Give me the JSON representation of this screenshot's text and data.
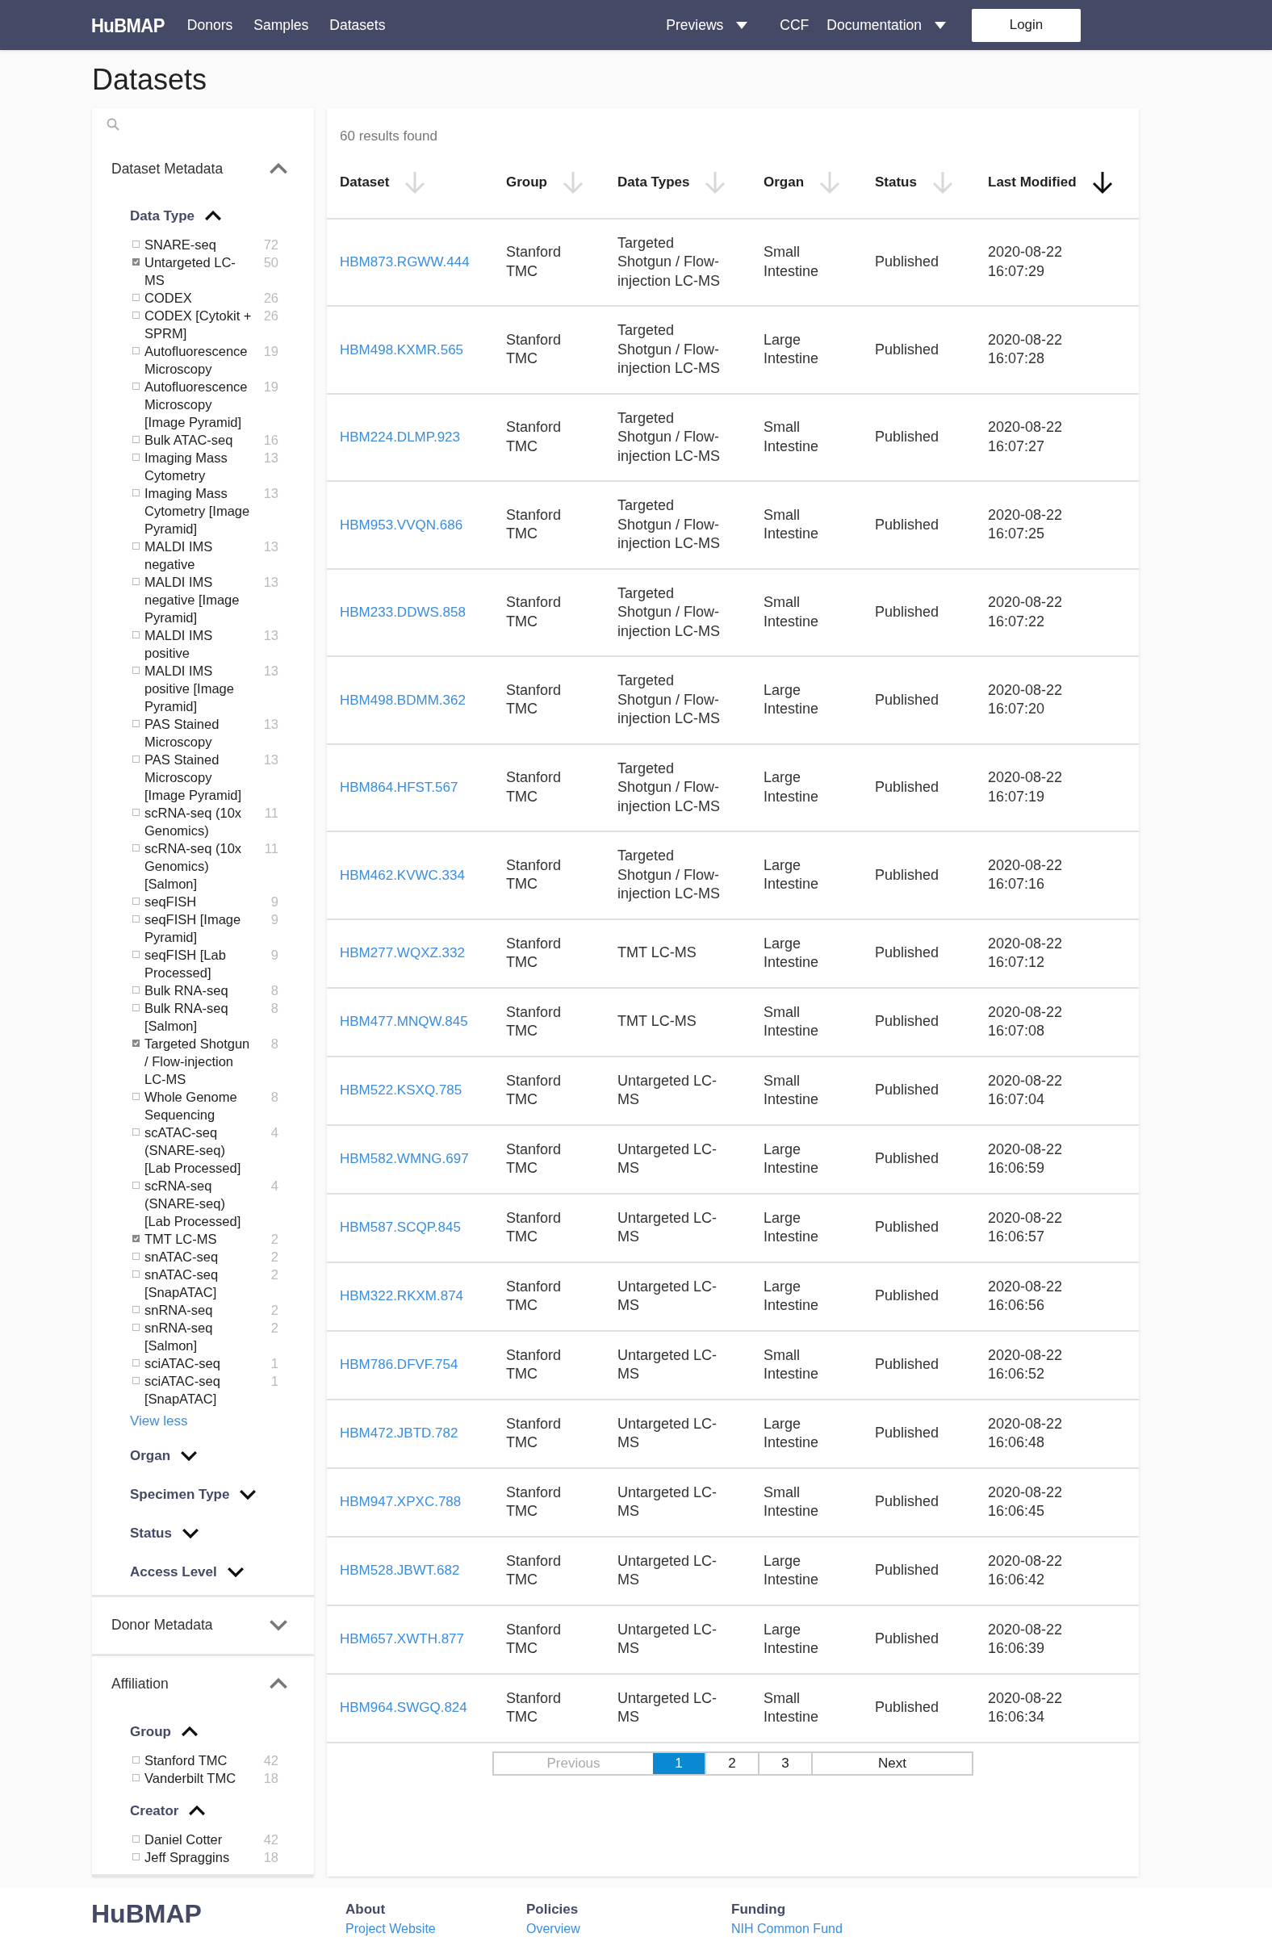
{
  "nav": {
    "logo": "HuBMAP",
    "links": [
      "Donors",
      "Samples",
      "Datasets"
    ],
    "right": [
      {
        "label": "Previews",
        "dropdown": true
      },
      {
        "label": "CCF",
        "dropdown": false
      },
      {
        "label": "Documentation",
        "dropdown": true
      }
    ],
    "login": "Login"
  },
  "page_title": "Datasets",
  "sidebar": {
    "sections": [
      {
        "title": "Dataset Metadata",
        "expanded": true,
        "facets": [
          {
            "title": "Data Type",
            "expanded": true,
            "items": [
              {
                "label": "SNARE-seq",
                "count": "72",
                "checked": false
              },
              {
                "label": "Untargeted LC-MS",
                "count": "50",
                "checked": true
              },
              {
                "label": "CODEX",
                "count": "26",
                "checked": false
              },
              {
                "label": "CODEX [Cytokit + SPRM]",
                "count": "26",
                "checked": false
              },
              {
                "label": "Autofluorescence Microscopy",
                "count": "19",
                "checked": false
              },
              {
                "label": "Autofluorescence Microscopy [Image Pyramid]",
                "count": "19",
                "checked": false
              },
              {
                "label": "Bulk ATAC-seq",
                "count": "16",
                "checked": false
              },
              {
                "label": "Imaging Mass Cytometry",
                "count": "13",
                "checked": false
              },
              {
                "label": "Imaging Mass Cytometry [Image Pyramid]",
                "count": "13",
                "checked": false
              },
              {
                "label": "MALDI IMS negative",
                "count": "13",
                "checked": false
              },
              {
                "label": "MALDI IMS negative [Image Pyramid]",
                "count": "13",
                "checked": false
              },
              {
                "label": "MALDI IMS positive",
                "count": "13",
                "checked": false
              },
              {
                "label": "MALDI IMS positive [Image Pyramid]",
                "count": "13",
                "checked": false
              },
              {
                "label": "PAS Stained Microscopy",
                "count": "13",
                "checked": false
              },
              {
                "label": "PAS Stained Microscopy [Image Pyramid]",
                "count": "13",
                "checked": false
              },
              {
                "label": "scRNA-seq (10x Genomics)",
                "count": "11",
                "checked": false
              },
              {
                "label": "scRNA-seq (10x Genomics) [Salmon]",
                "count": "11",
                "checked": false
              },
              {
                "label": "seqFISH",
                "count": "9",
                "checked": false
              },
              {
                "label": "seqFISH [Image Pyramid]",
                "count": "9",
                "checked": false
              },
              {
                "label": "seqFISH [Lab Processed]",
                "count": "9",
                "checked": false
              },
              {
                "label": "Bulk RNA-seq",
                "count": "8",
                "checked": false
              },
              {
                "label": "Bulk RNA-seq [Salmon]",
                "count": "8",
                "checked": false
              },
              {
                "label": "Targeted Shotgun / Flow-injection LC-MS",
                "count": "8",
                "checked": true
              },
              {
                "label": "Whole Genome Sequencing",
                "count": "8",
                "checked": false
              },
              {
                "label": "scATAC-seq (SNARE-seq) [Lab Processed]",
                "count": "4",
                "checked": false
              },
              {
                "label": "scRNA-seq (SNARE-seq) [Lab Processed]",
                "count": "4",
                "checked": false
              },
              {
                "label": "TMT LC-MS",
                "count": "2",
                "checked": true
              },
              {
                "label": "snATAC-seq",
                "count": "2",
                "checked": false
              },
              {
                "label": "snATAC-seq [SnapATAC]",
                "count": "2",
                "checked": false
              },
              {
                "label": "snRNA-seq",
                "count": "2",
                "checked": false
              },
              {
                "label": "snRNA-seq [Salmon]",
                "count": "2",
                "checked": false
              },
              {
                "label": "sciATAC-seq",
                "count": "1",
                "checked": false
              },
              {
                "label": "sciATAC-seq [SnapATAC]",
                "count": "1",
                "checked": false
              }
            ],
            "toggle": "View less"
          },
          {
            "title": "Organ",
            "expanded": false
          },
          {
            "title": "Specimen Type",
            "expanded": false
          },
          {
            "title": "Status",
            "expanded": false
          },
          {
            "title": "Access Level",
            "expanded": false
          }
        ]
      },
      {
        "title": "Donor Metadata",
        "expanded": false
      },
      {
        "title": "Affiliation",
        "expanded": true,
        "facets": [
          {
            "title": "Group",
            "expanded": true,
            "items": [
              {
                "label": "Stanford TMC",
                "count": "42",
                "checked": false
              },
              {
                "label": "Vanderbilt TMC",
                "count": "18",
                "checked": false
              }
            ]
          },
          {
            "title": "Creator",
            "expanded": true,
            "items": [
              {
                "label": "Daniel Cotter",
                "count": "42",
                "checked": false
              },
              {
                "label": "Jeff Spraggins",
                "count": "18",
                "checked": false
              }
            ]
          }
        ]
      }
    ]
  },
  "results": {
    "count_text": "60 results found",
    "columns": [
      {
        "label": "Dataset",
        "sorted": false
      },
      {
        "label": "Group",
        "sorted": false
      },
      {
        "label": "Data Types",
        "sorted": false
      },
      {
        "label": "Organ",
        "sorted": false
      },
      {
        "label": "Status",
        "sorted": false
      },
      {
        "label": "Last Modified",
        "sorted": true
      }
    ],
    "rows": [
      [
        "HBM873.RGWW.444",
        "Stanford TMC",
        "Targeted Shotgun / Flow-injection LC-MS",
        "Small Intestine",
        "Published",
        "2020-08-22 16:07:29"
      ],
      [
        "HBM498.KXMR.565",
        "Stanford TMC",
        "Targeted Shotgun / Flow-injection LC-MS",
        "Large Intestine",
        "Published",
        "2020-08-22 16:07:28"
      ],
      [
        "HBM224.DLMP.923",
        "Stanford TMC",
        "Targeted Shotgun / Flow-injection LC-MS",
        "Small Intestine",
        "Published",
        "2020-08-22 16:07:27"
      ],
      [
        "HBM953.VVQN.686",
        "Stanford TMC",
        "Targeted Shotgun / Flow-injection LC-MS",
        "Small Intestine",
        "Published",
        "2020-08-22 16:07:25"
      ],
      [
        "HBM233.DDWS.858",
        "Stanford TMC",
        "Targeted Shotgun / Flow-injection LC-MS",
        "Small Intestine",
        "Published",
        "2020-08-22 16:07:22"
      ],
      [
        "HBM498.BDMM.362",
        "Stanford TMC",
        "Targeted Shotgun / Flow-injection LC-MS",
        "Large Intestine",
        "Published",
        "2020-08-22 16:07:20"
      ],
      [
        "HBM864.HFST.567",
        "Stanford TMC",
        "Targeted Shotgun / Flow-injection LC-MS",
        "Large Intestine",
        "Published",
        "2020-08-22 16:07:19"
      ],
      [
        "HBM462.KVWC.334",
        "Stanford TMC",
        "Targeted Shotgun / Flow-injection LC-MS",
        "Large Intestine",
        "Published",
        "2020-08-22 16:07:16"
      ],
      [
        "HBM277.WQXZ.332",
        "Stanford TMC",
        "TMT LC-MS",
        "Large Intestine",
        "Published",
        "2020-08-22 16:07:12"
      ],
      [
        "HBM477.MNQW.845",
        "Stanford TMC",
        "TMT LC-MS",
        "Small Intestine",
        "Published",
        "2020-08-22 16:07:08"
      ],
      [
        "HBM522.KSXQ.785",
        "Stanford TMC",
        "Untargeted LC-MS",
        "Small Intestine",
        "Published",
        "2020-08-22 16:07:04"
      ],
      [
        "HBM582.WMNG.697",
        "Stanford TMC",
        "Untargeted LC-MS",
        "Large Intestine",
        "Published",
        "2020-08-22 16:06:59"
      ],
      [
        "HBM587.SCQP.845",
        "Stanford TMC",
        "Untargeted LC-MS",
        "Large Intestine",
        "Published",
        "2020-08-22 16:06:57"
      ],
      [
        "HBM322.RKXM.874",
        "Stanford TMC",
        "Untargeted LC-MS",
        "Large Intestine",
        "Published",
        "2020-08-22 16:06:56"
      ],
      [
        "HBM786.DFVF.754",
        "Stanford TMC",
        "Untargeted LC-MS",
        "Small Intestine",
        "Published",
        "2020-08-22 16:06:52"
      ],
      [
        "HBM472.JBTD.782",
        "Stanford TMC",
        "Untargeted LC-MS",
        "Large Intestine",
        "Published",
        "2020-08-22 16:06:48"
      ],
      [
        "HBM947.XPXC.788",
        "Stanford TMC",
        "Untargeted LC-MS",
        "Small Intestine",
        "Published",
        "2020-08-22 16:06:45"
      ],
      [
        "HBM528.JBWT.682",
        "Stanford TMC",
        "Untargeted LC-MS",
        "Large Intestine",
        "Published",
        "2020-08-22 16:06:42"
      ],
      [
        "HBM657.XWTH.877",
        "Stanford TMC",
        "Untargeted LC-MS",
        "Large Intestine",
        "Published",
        "2020-08-22 16:06:39"
      ],
      [
        "HBM964.SWGQ.824",
        "Stanford TMC",
        "Untargeted LC-MS",
        "Small Intestine",
        "Published",
        "2020-08-22 16:06:34"
      ]
    ],
    "pagination": {
      "previous": {
        "label": "Previous",
        "disabled": true
      },
      "pages": [
        {
          "label": "1",
          "selected": true
        },
        {
          "label": "2",
          "selected": false
        },
        {
          "label": "3",
          "selected": false
        }
      ],
      "next": {
        "label": "Next",
        "disabled": false
      }
    }
  },
  "footer": {
    "logo": "HuBMAP",
    "columns": [
      {
        "title": "About",
        "link": "Project Website"
      },
      {
        "title": "Policies",
        "link": "Overview"
      },
      {
        "title": "Funding",
        "link": "NIH Common Fund"
      }
    ]
  }
}
